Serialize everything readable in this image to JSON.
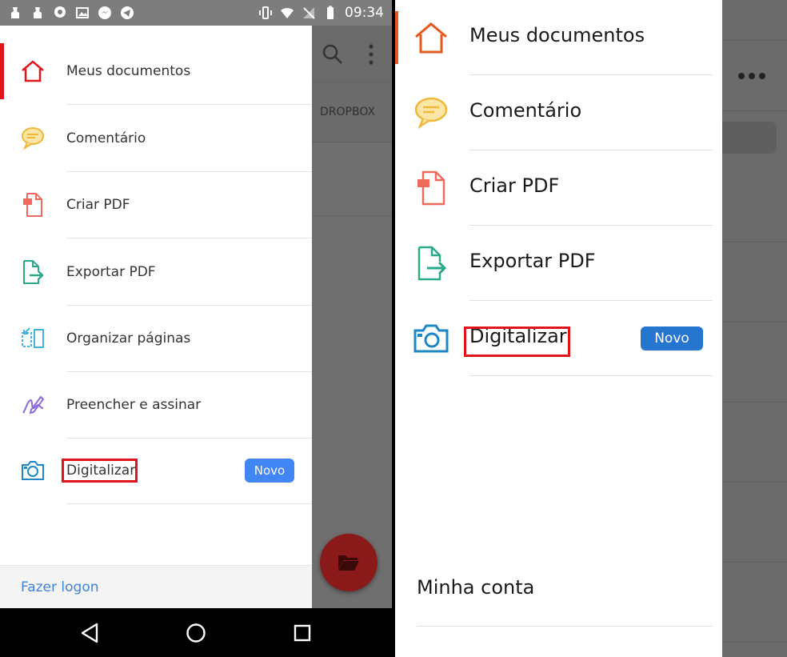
{
  "left": {
    "statusbar": {
      "time": "09:34"
    },
    "behind": {
      "tab_label": "DROPBOX"
    },
    "menu": [
      {
        "label": "Meus documentos",
        "icon": "home-icon"
      },
      {
        "label": "Comentário",
        "icon": "comment-icon"
      },
      {
        "label": "Criar PDF",
        "icon": "create-pdf-icon"
      },
      {
        "label": "Exportar PDF",
        "icon": "export-pdf-icon"
      },
      {
        "label": "Organizar páginas",
        "icon": "organize-pages-icon"
      },
      {
        "label": "Preencher e assinar",
        "icon": "fill-sign-icon"
      },
      {
        "label": "Digitalizar",
        "icon": "camera-icon",
        "badge": "Novo"
      }
    ],
    "footer": {
      "login": "Fazer logon"
    }
  },
  "right": {
    "menu": [
      {
        "label": "Meus documentos",
        "icon": "home-icon"
      },
      {
        "label": "Comentário",
        "icon": "comment-icon"
      },
      {
        "label": "Criar PDF",
        "icon": "create-pdf-icon"
      },
      {
        "label": "Exportar PDF",
        "icon": "export-pdf-icon"
      },
      {
        "label": "Digitalizar",
        "icon": "camera-icon",
        "badge": "Novo"
      }
    ],
    "account": "Minha conta"
  },
  "colors": {
    "accent_red": "#e2131a",
    "accent_orange": "#e8571b",
    "badge_blue_android": "#4285f4",
    "badge_blue_ios": "#2676d0",
    "link_blue": "#3f83d8"
  }
}
